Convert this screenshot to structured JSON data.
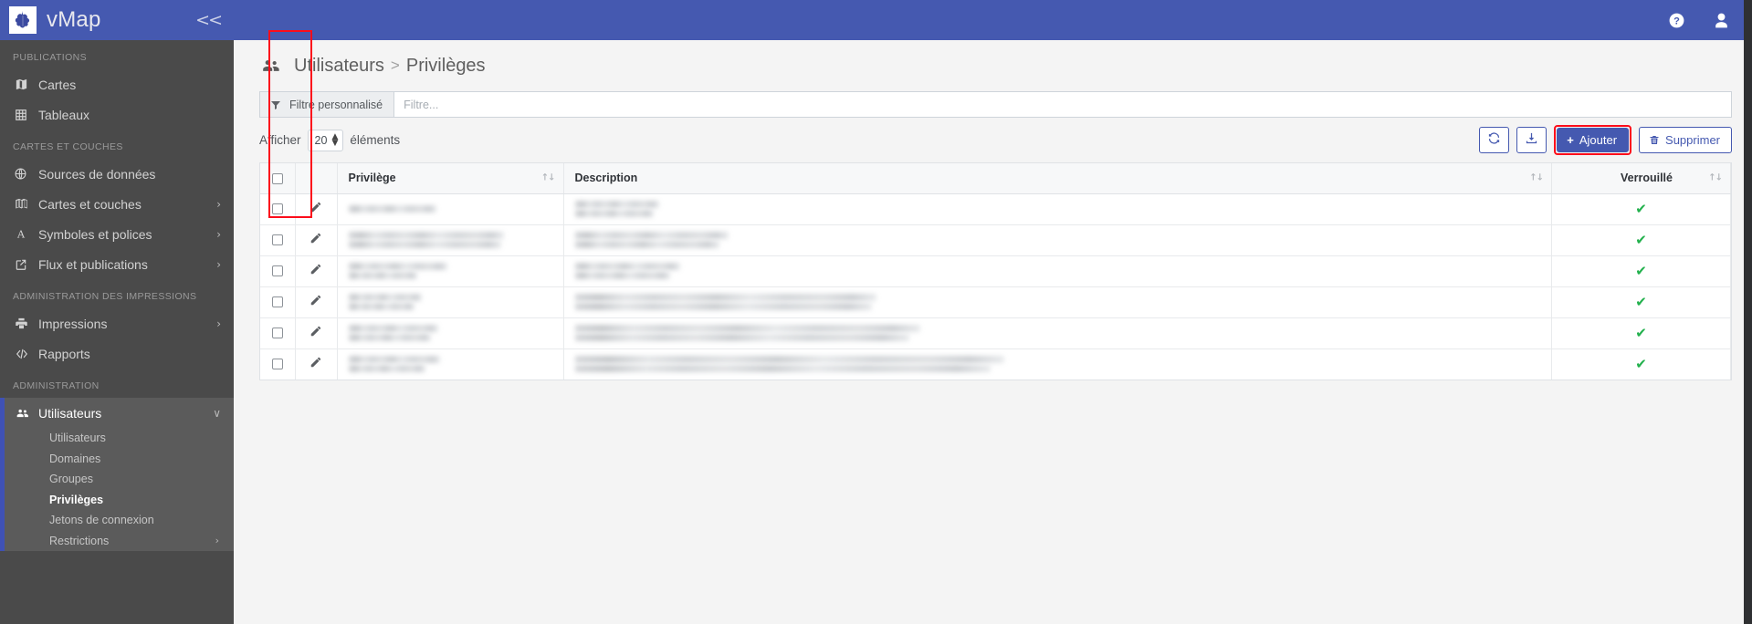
{
  "brand": {
    "title": "vMap",
    "collapse_label": "<<",
    "logo_icon": "grape-leaf-logo"
  },
  "topbar": {
    "help_icon": "help-circle-icon",
    "user_icon": "user-account-icon"
  },
  "sidebar": {
    "sections": [
      {
        "title": "PUBLICATIONS",
        "items": [
          {
            "label": "Cartes",
            "icon": "map-icon",
            "caret": ""
          },
          {
            "label": "Tableaux",
            "icon": "table-grid-icon",
            "caret": ""
          }
        ]
      },
      {
        "title": "CARTES ET COUCHES",
        "items": [
          {
            "label": "Sources de données",
            "icon": "globe-icon",
            "caret": ""
          },
          {
            "label": "Cartes et couches",
            "icon": "layers-map-icon",
            "caret": "›"
          },
          {
            "label": "Symboles et polices",
            "icon": "font-a-icon",
            "caret": "›"
          },
          {
            "label": "Flux et publications",
            "icon": "external-link-icon",
            "caret": "›"
          }
        ]
      },
      {
        "title": "ADMINISTRATION DES IMPRESSIONS",
        "items": [
          {
            "label": "Impressions",
            "icon": "printer-icon",
            "caret": "›"
          },
          {
            "label": "Rapports",
            "icon": "code-brackets-icon",
            "caret": ""
          }
        ]
      },
      {
        "title": "ADMINISTRATION",
        "items": [
          {
            "label": "Utilisateurs",
            "icon": "users-group-icon",
            "caret": "∨",
            "active": true
          }
        ]
      }
    ],
    "subitems": [
      {
        "label": "Utilisateurs",
        "caret": "",
        "current": false
      },
      {
        "label": "Domaines",
        "caret": "",
        "current": false
      },
      {
        "label": "Groupes",
        "caret": "",
        "current": false
      },
      {
        "label": "Privilèges",
        "caret": "",
        "current": true
      },
      {
        "label": "Jetons de connexion",
        "caret": "",
        "current": false
      },
      {
        "label": "Restrictions",
        "caret": "›",
        "current": false
      }
    ]
  },
  "page": {
    "icon": "users-group-icon",
    "breadcrumb_parent": "Utilisateurs",
    "breadcrumb_separator": ">",
    "breadcrumb_current": "Privilèges"
  },
  "filter": {
    "icon": "funnel-filter-icon",
    "button_label": "Filtre personnalisé",
    "input_value": "",
    "input_placeholder": "Filtre..."
  },
  "tools": {
    "show_label": "Afficher",
    "page_size": "20",
    "entries_label": "éléments",
    "refresh_icon": "refresh-circular-icon",
    "export_icon": "download-export-icon",
    "add_icon": "plus-icon",
    "add_label": "Ajouter",
    "delete_icon": "trash-bin-icon",
    "delete_label": "Supprimer",
    "add_button_highlight_color": "#fc0d1b",
    "primary_color": "#4559b0"
  },
  "table": {
    "columns": [
      {
        "key": "check",
        "label": "",
        "sortable": false
      },
      {
        "key": "edit",
        "label": "",
        "sortable": false
      },
      {
        "key": "priv",
        "label": "Privilège",
        "sortable": true
      },
      {
        "key": "desc",
        "label": "Description",
        "sortable": true
      },
      {
        "key": "lock",
        "label": "Verrouillé",
        "sortable": true
      }
    ],
    "sort_glyph": "↑↓",
    "row_edit_icon": "pencil-edit-icon",
    "locked_true_glyph": "✔",
    "locked_color": "#23b14d",
    "rows": [
      {
        "privilege": "[redacted]",
        "privilege_blur": [
          96,
          0
        ],
        "description": "[redacted]",
        "description_blur": [
          92,
          86
        ],
        "locked": true
      },
      {
        "privilege": "[redacted]",
        "privilege_blur": [
          170,
          167
        ],
        "description": "[redacted]",
        "description_blur": [
          168,
          158
        ],
        "locked": true
      },
      {
        "privilege": "[redacted]",
        "privilege_blur": [
          108,
          75
        ],
        "description": "[redacted]",
        "description_blur": [
          115,
          104
        ],
        "locked": true
      },
      {
        "privilege": "[redacted]",
        "privilege_blur": [
          80,
          72
        ],
        "description": "[redacted]",
        "description_blur": [
          330,
          325
        ],
        "locked": true
      },
      {
        "privilege": "[redacted]",
        "privilege_blur": [
          98,
          90
        ],
        "description": "[redacted]",
        "description_blur": [
          378,
          366
        ],
        "locked": true
      },
      {
        "privilege": "[redacted]",
        "privilege_blur": [
          100,
          84
        ],
        "description": "[redacted]",
        "description_blur": [
          470,
          455
        ],
        "locked": true
      }
    ]
  },
  "annotations": {
    "edit_column_highlight_color": "#fc0d1b"
  }
}
